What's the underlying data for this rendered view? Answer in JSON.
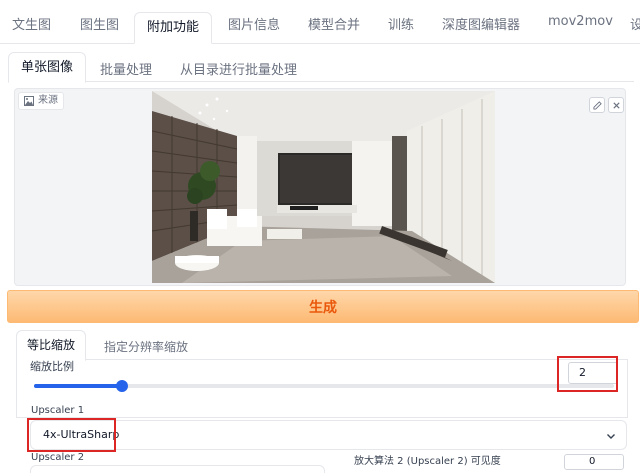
{
  "top_tabs": [
    "文生图",
    "图生图",
    "附加功能",
    "图片信息",
    "模型合并",
    "训练",
    "深度图编辑器",
    "mov2mov",
    "设"
  ],
  "active_top_tab": "附加功能",
  "sub_tabs": [
    "单张图像",
    "批量处理",
    "从目录进行批量处理"
  ],
  "image_source": {
    "label": "来源",
    "icons": [
      "image-icon",
      "edit-icon",
      "close-icon"
    ]
  },
  "generate_label": "生成",
  "scale_tabs": [
    "等比缩放",
    "指定分辨率缩放"
  ],
  "resize": {
    "label": "缩放比例",
    "value": "2",
    "slider_fraction": 0.152
  },
  "upscaler1": {
    "label": "Upscaler 1",
    "value": "4x-UltraSharp"
  },
  "upscaler2": {
    "label": "Upscaler 2"
  },
  "upscaler2_visibility": {
    "label": "放大算法 2 (Upscaler 2) 可见度",
    "value": "0"
  },
  "colors": {
    "accent": "#2563eb",
    "generate": "#ea580c",
    "highlight": "#dc2626"
  }
}
